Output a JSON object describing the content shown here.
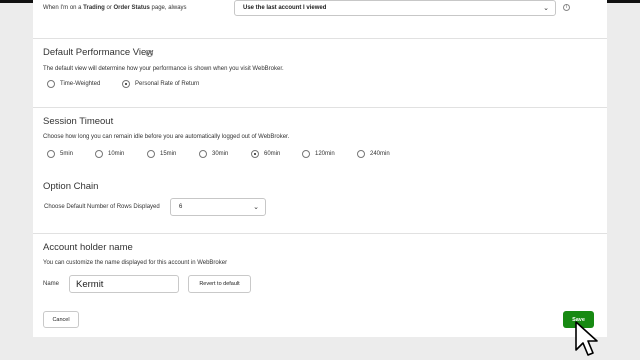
{
  "account_row": {
    "label_prefix": "When I'm on a ",
    "label_trading": "Trading",
    "label_or": " or ",
    "label_order_status": "Order Status",
    "label_suffix": " page, always",
    "select_value": "Use the last account I viewed",
    "info_icon": "info-icon"
  },
  "performance_view": {
    "title": "Default Performance View",
    "description": "The default view will determine how your performance is shown when you visit WebBroker.",
    "options": [
      "Time-Weighted",
      "Personal Rate of Return"
    ],
    "selected": "Personal Rate of Return"
  },
  "session_timeout": {
    "title": "Session Timeout",
    "description": "Choose how long you can remain idle before you are automatically logged out of WebBroker.",
    "options": [
      "5min",
      "10min",
      "15min",
      "30min",
      "60min",
      "120min",
      "240min"
    ],
    "selected": "60min"
  },
  "option_chain": {
    "title": "Option Chain",
    "label": "Choose Default Number of Rows Displayed",
    "select_value": "6"
  },
  "account_holder": {
    "title": "Account holder name",
    "description": "You can customize the name displayed for this account in WebBroker",
    "name_label": "Name",
    "name_value": "Kermit",
    "revert_label": "Revert to default"
  },
  "footer": {
    "cancel_label": "Cancel",
    "save_label": "Save"
  },
  "colors": {
    "save_button": "#178a12",
    "page_background": "#ececec"
  }
}
